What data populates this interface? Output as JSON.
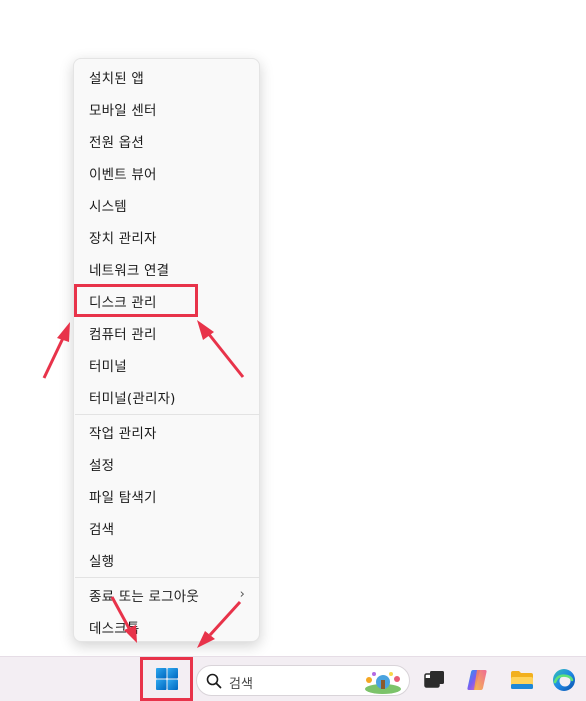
{
  "context_menu": {
    "items": [
      {
        "label": "설치된 앱"
      },
      {
        "label": "모바일 센터"
      },
      {
        "label": "전원 옵션"
      },
      {
        "label": "이벤트 뷰어"
      },
      {
        "label": "시스템"
      },
      {
        "label": "장치 관리자"
      },
      {
        "label": "네트워크 연결"
      },
      {
        "label": "디스크 관리",
        "highlighted": true
      },
      {
        "label": "컴퓨터 관리"
      },
      {
        "label": "터미널"
      },
      {
        "label": "터미널(관리자)"
      },
      {
        "label": "작업 관리자"
      },
      {
        "label": "설정"
      },
      {
        "label": "파일 탐색기"
      },
      {
        "label": "검색"
      },
      {
        "label": "실행"
      },
      {
        "label": "종료 또는 로그아웃",
        "has_submenu": true
      },
      {
        "label": "데스크톱"
      }
    ]
  },
  "taskbar": {
    "search_label": "검색",
    "icons": [
      "windows-start-icon",
      "search-icon",
      "task-view-icon",
      "copilot-icon",
      "file-explorer-icon",
      "edge-icon"
    ]
  },
  "colors": {
    "annotation": "#e8334a",
    "windows_blue": "#0078d4"
  }
}
